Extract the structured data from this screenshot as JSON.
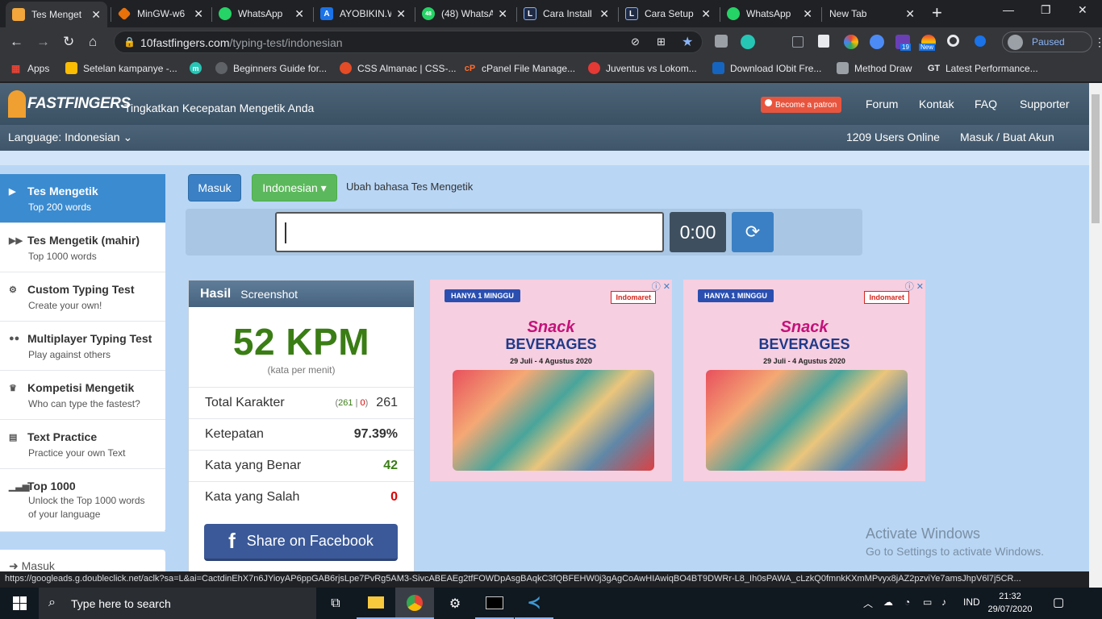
{
  "browser": {
    "tabs": [
      {
        "title": "Tes Menget",
        "color": "#f2a63b",
        "active": true
      },
      {
        "title": "MinGW-w6",
        "color": "#e8710a"
      },
      {
        "title": "WhatsApp",
        "color": "#25d366"
      },
      {
        "title": "AYOBIKIN.W",
        "color": "#1a73e8"
      },
      {
        "title": "(48) WhatsA",
        "color": "#25d366"
      },
      {
        "title": "Cara Install",
        "color": "#1f2a44"
      },
      {
        "title": "Cara Setup",
        "color": "#1f2a44"
      },
      {
        "title": "WhatsApp",
        "color": "#25d366"
      },
      {
        "title": "New Tab",
        "color": ""
      }
    ],
    "url_host": "10fastfingers.com",
    "url_path": "/typing-test/indonesian",
    "profile_status": "Paused",
    "ext_badges": {
      "b19": "19",
      "bnew": "New"
    },
    "bookmarks": [
      {
        "label": "Apps"
      },
      {
        "label": "Setelan kampanye -..."
      },
      {
        "label": ""
      },
      {
        "label": "Beginners Guide for..."
      },
      {
        "label": "CSS Almanac | CSS-..."
      },
      {
        "label": "cPanel File Manage..."
      },
      {
        "label": "Juventus vs Lokom..."
      },
      {
        "label": "Download IObit Fre..."
      },
      {
        "label": "Method Draw"
      },
      {
        "label": "Latest Performance..."
      }
    ]
  },
  "site": {
    "logo": "FASTFINGERS",
    "tagline": "Tingkatkan Kecepatan Mengetik Anda",
    "patron": "Become a patron",
    "nav": [
      "Forum",
      "Kontak",
      "FAQ",
      "Supporter"
    ],
    "language_label": "Language: Indonesian",
    "users_online": "1209 Users Online",
    "login": "Masuk / Buat Akun",
    "sidebar": [
      {
        "title": "Tes Mengetik",
        "sub": "Top 200 words",
        "icon": "▶"
      },
      {
        "title": "Tes Mengetik (mahir)",
        "sub": "Top 1000 words",
        "icon": "▶▶"
      },
      {
        "title": "Custom Typing Test",
        "sub": "Create your own!",
        "icon": "⚙"
      },
      {
        "title": "Multiplayer Typing Test",
        "sub": "Play against others",
        "icon": "👥"
      },
      {
        "title": "Kompetisi Mengetik",
        "sub": "Who can type the fastest?",
        "icon": "🏆"
      },
      {
        "title": "Text Practice",
        "sub": "Practice your own Text",
        "icon": "📄"
      },
      {
        "title": "Top 1000",
        "sub": "Unlock the Top 1000 words of your language",
        "icon": "▁▃▅"
      }
    ],
    "sidebar_login": "Masuk",
    "btn_masuk": "Masuk",
    "btn_lang": "Indonesian ▾",
    "lang_hint": "Ubah bahasa Tes Mengetik",
    "timer": "0:00",
    "result": {
      "head": "Hasil",
      "screenshot": "Screenshot",
      "wpm": "52 KPM",
      "wpm_sub": "(kata per menit)",
      "rows": [
        {
          "label": "Total Karakter",
          "correct": "261",
          "wrong": "0",
          "value": "261"
        },
        {
          "label": "Ketepatan",
          "value": "97.39%"
        },
        {
          "label": "Kata yang Benar",
          "value": "42"
        },
        {
          "label": "Kata yang Salah",
          "value": "0"
        }
      ],
      "share": "Share on Facebook"
    },
    "ad": {
      "top": "HANYA 1 MINGGU",
      "brand": "Indomaret",
      "t1": "Snack",
      "t2": "BEVERAGES",
      "t3": "29 Juli - 4 Agustus 2020"
    },
    "activate_1": "Activate Windows",
    "activate_2": "Go to Settings to activate Windows."
  },
  "status_url": "https://googleads.g.doubleclick.net/aclk?sa=L&ai=CactdinEhX7n6JYioyAP6ppGAB6rjsLpe7PvRg5AM3-SivcABEAEg2tfFOWDpAsgBAqkC3fQBFEHW0j3gAgCoAwHIAwiqBO4BT9DWRr-L8_Ih0sPAWA_cLzkQ0fmnkKXmMPvyx8jAZ2pzviYe7amsJhpV6l7j5CR...",
  "taskbar": {
    "search": "Type here to search",
    "lang": "IND",
    "time": "21:32",
    "date": "29/07/2020"
  },
  "colors": {
    "accent": "#3b80c4",
    "wpm": "#3a7d15",
    "success": "#5cb85c"
  }
}
